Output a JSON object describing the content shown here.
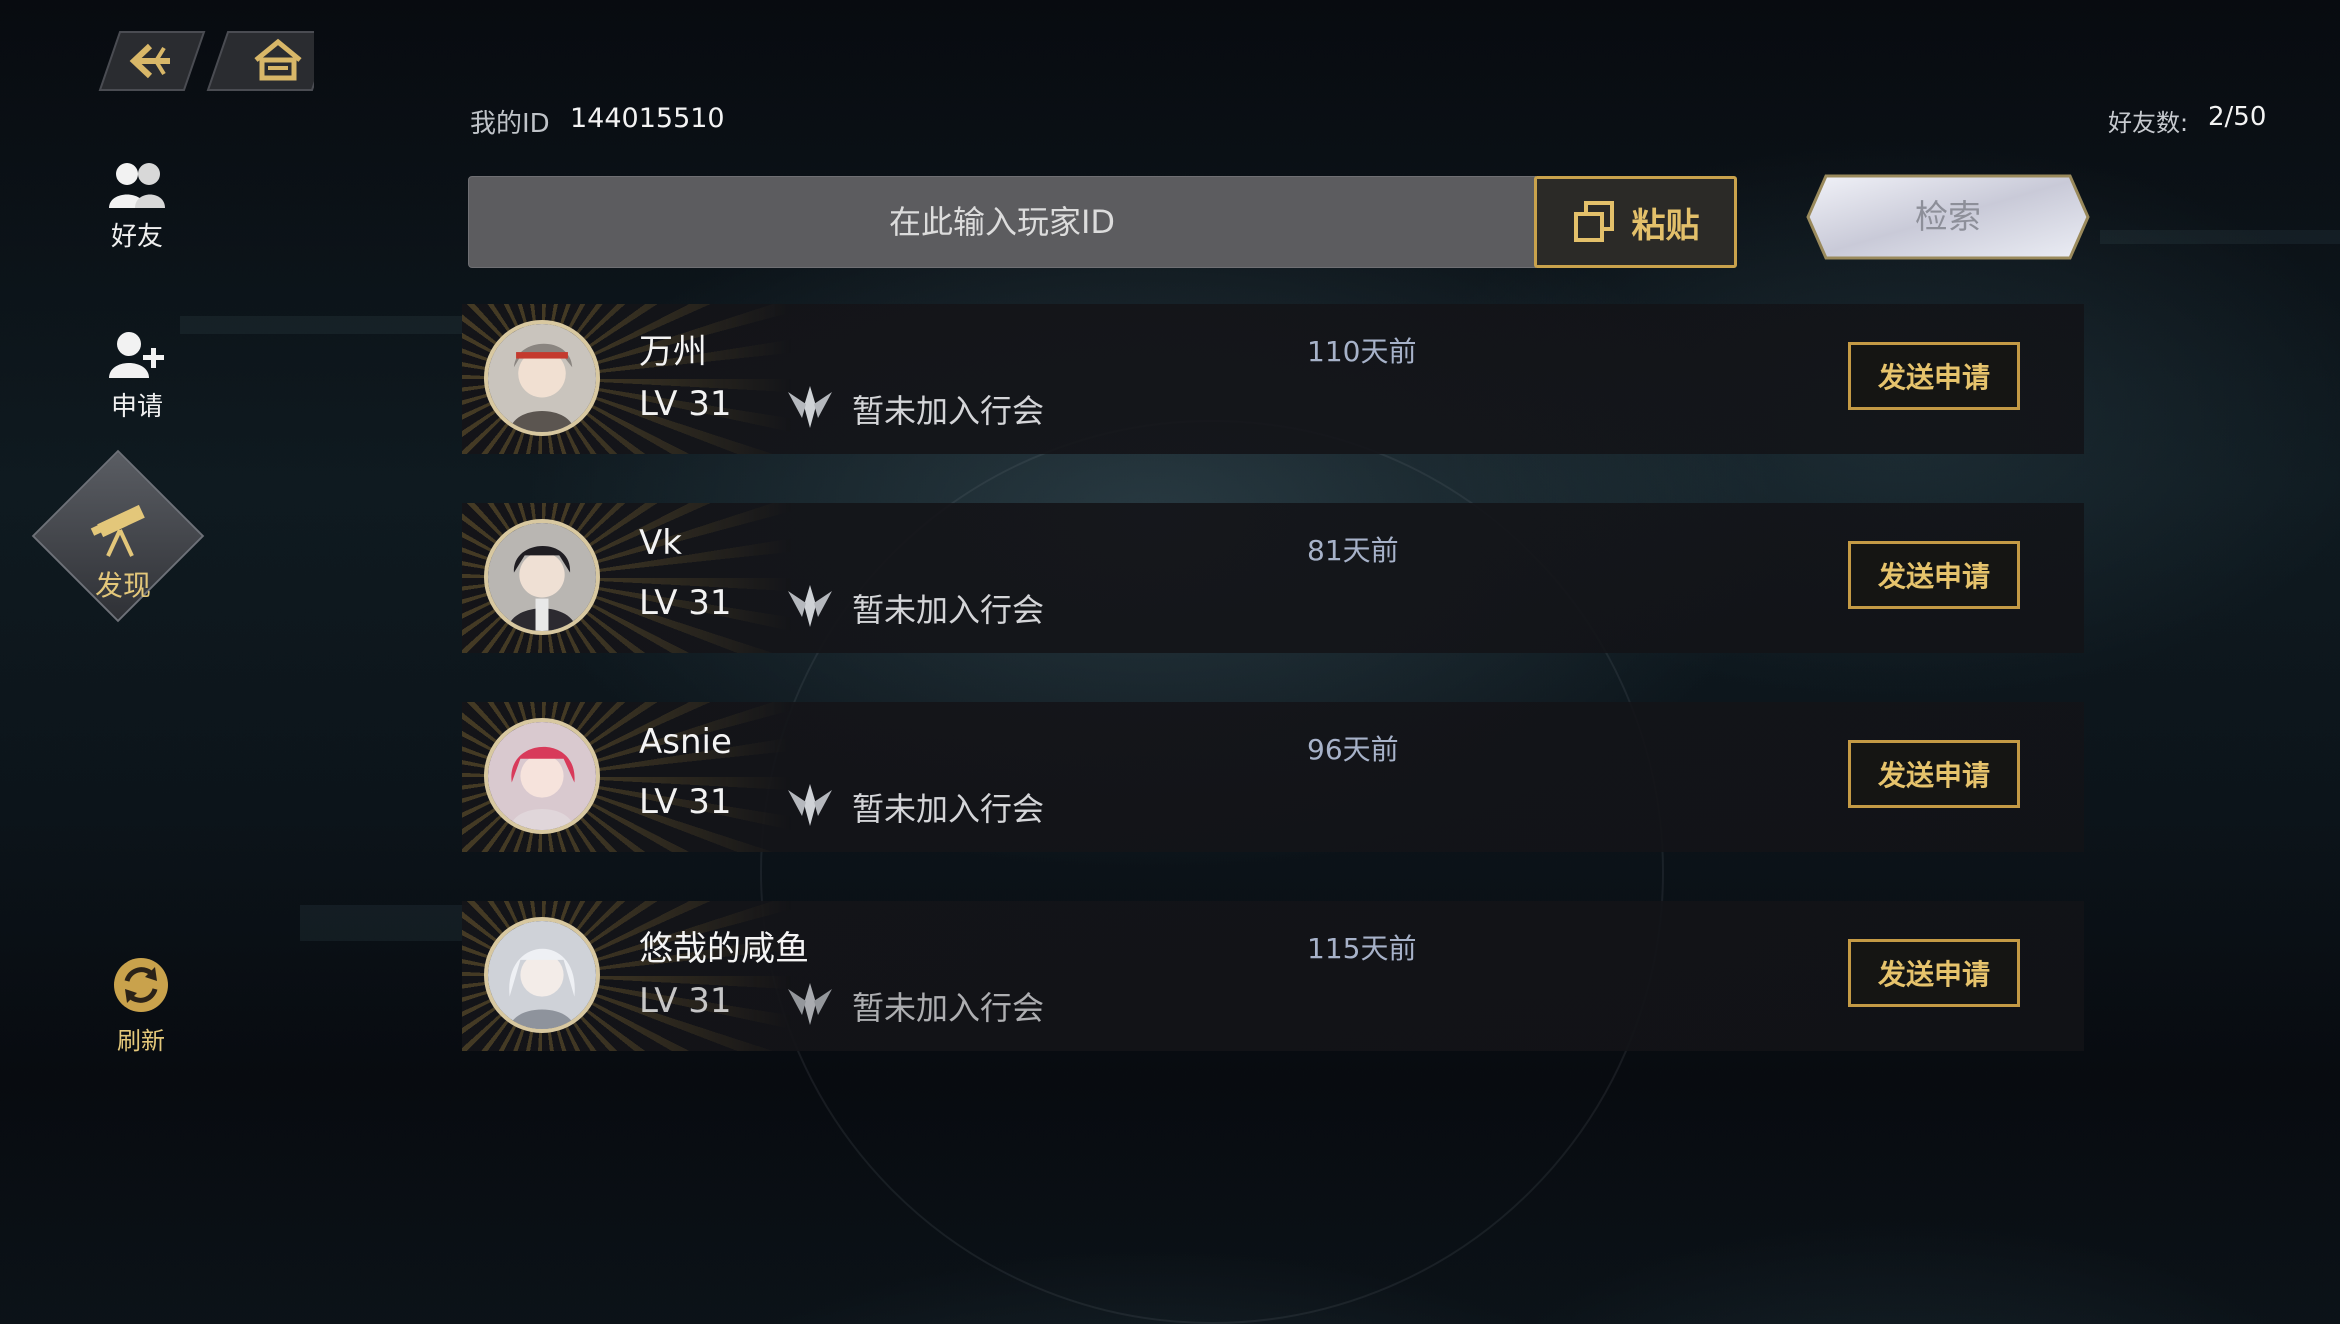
{
  "nav": {
    "back_icon": "back-arrow-icon",
    "home_icon": "home-icon"
  },
  "sidebar": {
    "items": [
      {
        "label": "好友",
        "icon": "friends-icon"
      },
      {
        "label": "申请",
        "icon": "add-friend-icon"
      },
      {
        "label": "发现",
        "icon": "telescope-icon",
        "active": true
      },
      {
        "label": "刷新",
        "icon": "refresh-icon"
      }
    ]
  },
  "header": {
    "my_id_label": "我的ID",
    "my_id_value": "144015510",
    "friend_count_label": "好友数:",
    "friend_count_value": "2/50"
  },
  "search": {
    "placeholder": "在此输入玩家ID",
    "paste_label": "粘贴",
    "search_label": "检索"
  },
  "players": [
    {
      "name": "万州",
      "level": "LV 31",
      "guild": "暂未加入行会",
      "last_seen": "110天前",
      "action": "发送申请"
    },
    {
      "name": "Vk",
      "level": "LV 31",
      "guild": "暂未加入行会",
      "last_seen": "81天前",
      "action": "发送申请"
    },
    {
      "name": "Asnie",
      "level": "LV 31",
      "guild": "暂未加入行会",
      "last_seen": "96天前",
      "action": "发送申请"
    },
    {
      "name": "悠哉的咸鱼",
      "level": "LV 31",
      "guild": "暂未加入行会",
      "last_seen": "115天前",
      "action": "发送申请"
    }
  ],
  "colors": {
    "gold": "#c9a24c",
    "gold_text": "#e3c06a",
    "last_seen": "#a7b2c9"
  }
}
